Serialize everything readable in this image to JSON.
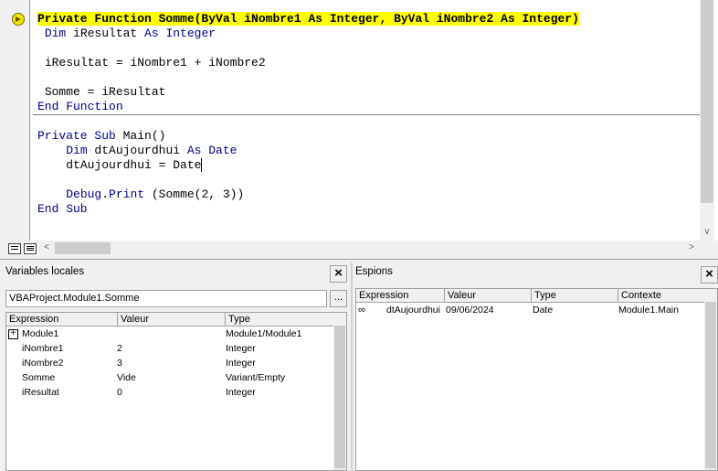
{
  "editor": {
    "function_block": {
      "line1": "Private Function Somme(ByVal iNombre1 As Integer, ByVal iNombre2 As Integer)",
      "line2_kw1": "Dim",
      "line2_var": " iResultat ",
      "line2_kw2": "As Integer",
      "line3": "iResultat = iNombre1 + iNombre2",
      "line4": "Somme = iResultat",
      "line5": "End Function"
    },
    "sub_block": {
      "line1_kw": "Private Sub",
      "line1_rest": " Main()",
      "line2_kw1": "Dim",
      "line2_var": " dtAujourdhui ",
      "line2_kw2": "As Date",
      "line3": "dtAujourdhui = Date",
      "line4_obj": "Debug",
      "line4_dot": ".",
      "line4_kw": "Print",
      "line4_rest": " (Somme(2, 3))",
      "line5": "End Sub"
    },
    "hscroll_left": "<",
    "hscroll_right": ">",
    "vscroll_down": "v"
  },
  "locals": {
    "title": "Variables locales",
    "close": "×",
    "context": "VBAProject.Module1.Somme",
    "context_button": "...",
    "headers": [
      "Expression",
      "Valeur",
      "Type"
    ],
    "rows": [
      {
        "expander": "+",
        "expression": "Module1",
        "value": "",
        "type": "Module1/Module1"
      },
      {
        "expander": "",
        "expression": "iNombre1",
        "value": "2",
        "type": "Integer"
      },
      {
        "expander": "",
        "expression": "iNombre2",
        "value": "3",
        "type": "Integer"
      },
      {
        "expander": "",
        "expression": "Somme",
        "value": "Vide",
        "type": "Variant/Empty"
      },
      {
        "expander": "",
        "expression": "iResultat",
        "value": "0",
        "type": "Integer"
      }
    ]
  },
  "watches": {
    "title": "Espions",
    "close": "×",
    "headers": [
      "Expression",
      "Valeur",
      "Type",
      "Contexte"
    ],
    "rows": [
      {
        "expression": "dtAujourdhui",
        "value": "09/06/2024",
        "type": "Date",
        "context": "Module1.Main"
      }
    ]
  }
}
